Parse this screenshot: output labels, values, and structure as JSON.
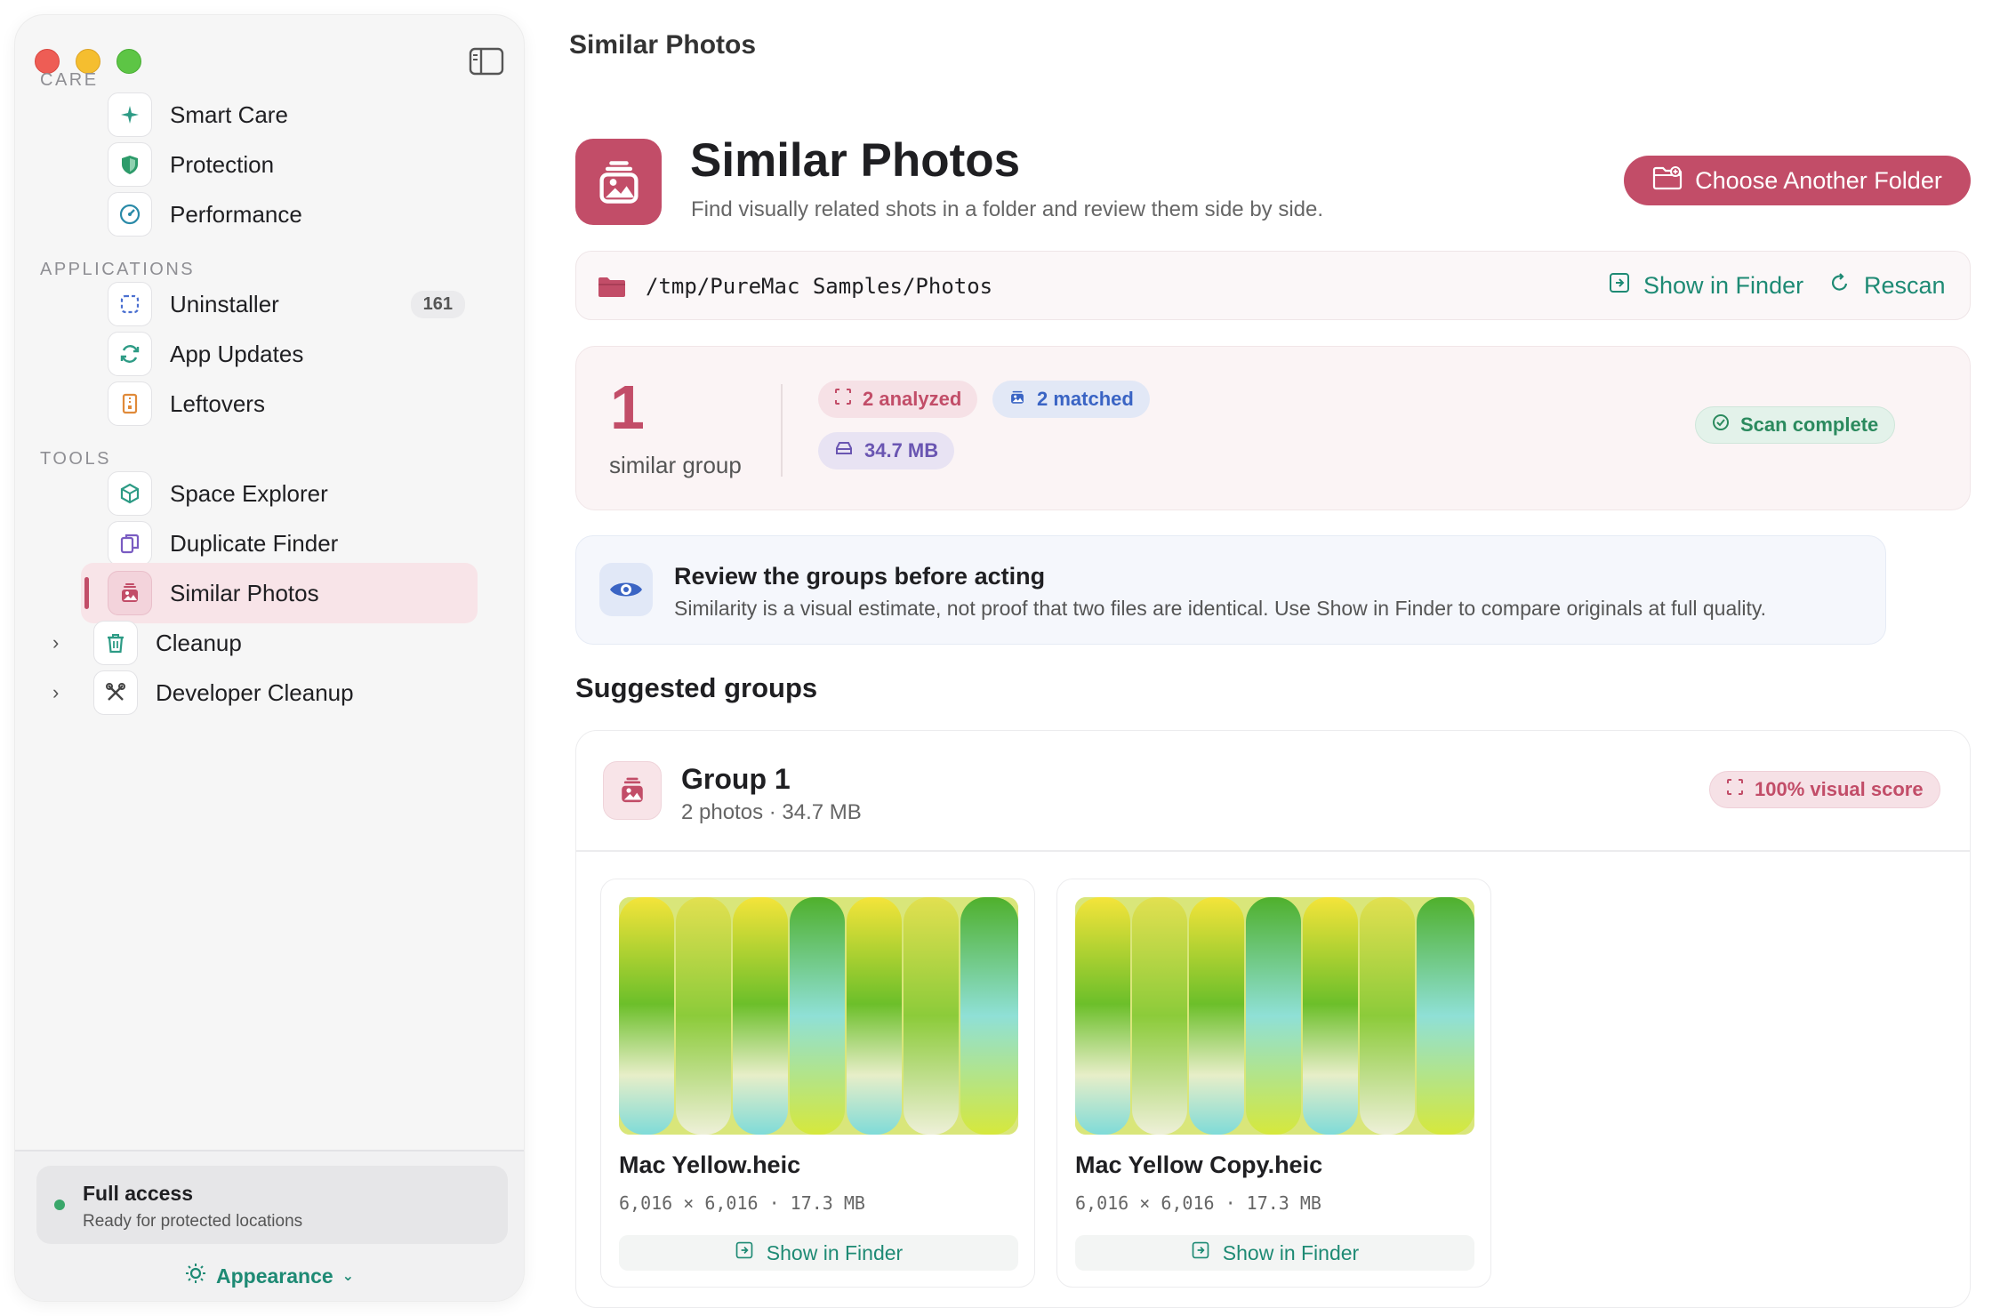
{
  "window": {
    "title": "Similar Photos"
  },
  "sidebar": {
    "sections": {
      "care": "CARE",
      "applications": "APPLICATIONS",
      "tools": "TOOLS"
    },
    "items": {
      "smart_care": "Smart Care",
      "protection": "Protection",
      "performance": "Performance",
      "uninstaller": "Uninstaller",
      "uninstaller_count": "161",
      "app_updates": "App Updates",
      "leftovers": "Leftovers",
      "space_explorer": "Space Explorer",
      "duplicate_finder": "Duplicate Finder",
      "similar_photos": "Similar Photos",
      "cleanup": "Cleanup",
      "developer_cleanup": "Developer Cleanup"
    },
    "active_item": "similar_photos",
    "footer": {
      "access_title": "Full access",
      "access_sub": "Ready for protected locations",
      "appearance": "Appearance"
    }
  },
  "header": {
    "title": "Similar Photos",
    "subtitle": "Find visually related shots in a folder and review them side by side.",
    "choose_button": "Choose Another Folder"
  },
  "path_bar": {
    "path": "/tmp/PureMac Samples/Photos",
    "show_in_finder": "Show in Finder",
    "rescan": "Rescan"
  },
  "stats": {
    "count": "1",
    "label": "similar group",
    "analyzed": "2 analyzed",
    "matched": "2 matched",
    "size": "34.7 MB",
    "status": "Scan complete"
  },
  "notice": {
    "title": "Review the groups before acting",
    "text": "Similarity is a visual estimate, not proof that two files are identical. Use Show in Finder to compare originals at full quality."
  },
  "groups_title": "Suggested groups",
  "group": {
    "title": "Group 1",
    "subtitle": "2 photos · 34.7 MB",
    "score": "100% visual score",
    "photos": [
      {
        "name": "Mac Yellow.heic",
        "meta": "6,016 × 6,016 · 17.3 MB",
        "action": "Show in Finder"
      },
      {
        "name": "Mac Yellow Copy.heic",
        "meta": "6,016 × 6,016 · 17.3 MB",
        "action": "Show in Finder"
      }
    ]
  },
  "colors": {
    "accent": "#c24d68",
    "teal": "#1e8a74",
    "success": "#2b8a5e"
  }
}
